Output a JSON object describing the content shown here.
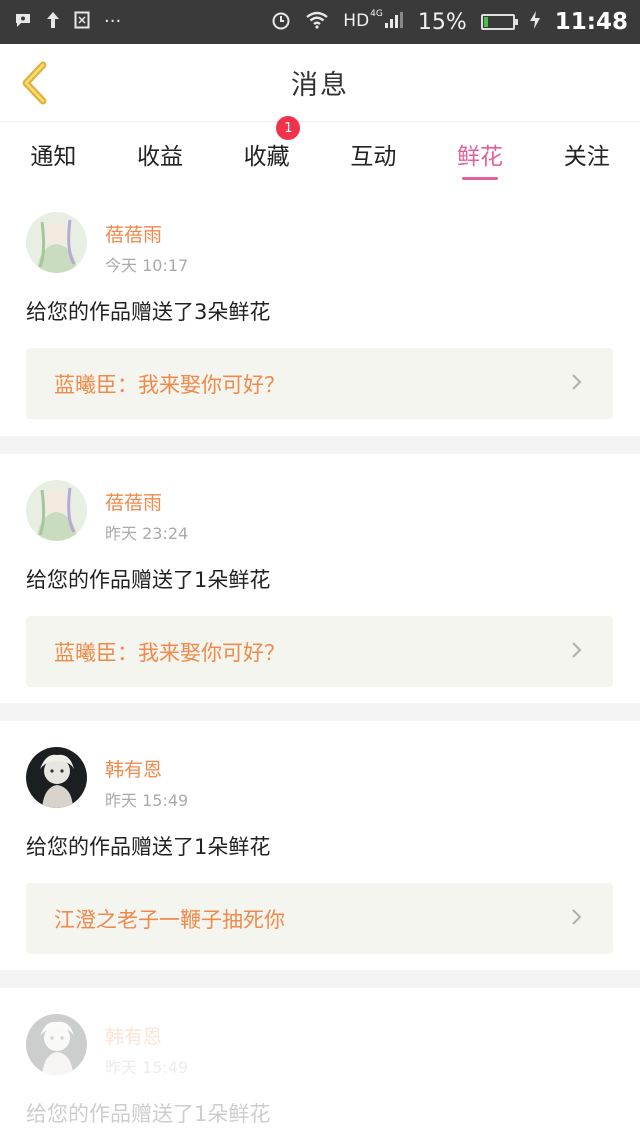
{
  "status_bar": {
    "time": "11:48",
    "battery_text": "15%",
    "network_hd": "HD",
    "network_type": "4G",
    "battery_level": 0.15,
    "icons": [
      "notification-icon",
      "upload-icon",
      "screenshot-icon",
      "more-dots-icon",
      "alarm-icon",
      "wifi-icon",
      "signal-icon",
      "battery-icon",
      "charging-icon"
    ]
  },
  "header": {
    "title": "消息"
  },
  "tabs": [
    {
      "label": "通知"
    },
    {
      "label": "收益"
    },
    {
      "label": "收藏",
      "badge": "1"
    },
    {
      "label": "互动"
    },
    {
      "label": "鲜花",
      "active": true
    },
    {
      "label": "关注"
    }
  ],
  "messages": [
    {
      "user": "蓓蓓雨",
      "time": "今天  10:17",
      "text": "给您的作品赠送了3朵鲜花",
      "quote": "蓝曦臣：我来娶你可好？"
    },
    {
      "user": "蓓蓓雨",
      "time": "昨天  23:24",
      "text": "给您的作品赠送了1朵鲜花",
      "quote": "蓝曦臣：我来娶你可好？"
    },
    {
      "user": "韩有恩",
      "time": "昨天  15:49",
      "text": "给您的作品赠送了1朵鲜花",
      "quote": "江澄之老子一鞭子抽死你"
    },
    {
      "user": "韩有恩",
      "time": "昨天  15:49",
      "text": "给您的作品赠送了1朵鲜花"
    }
  ],
  "colors": {
    "accent": "#e5609a",
    "username": "#f08a4b",
    "badge": "#f0324a",
    "back_arrow": "#e0b23c"
  }
}
